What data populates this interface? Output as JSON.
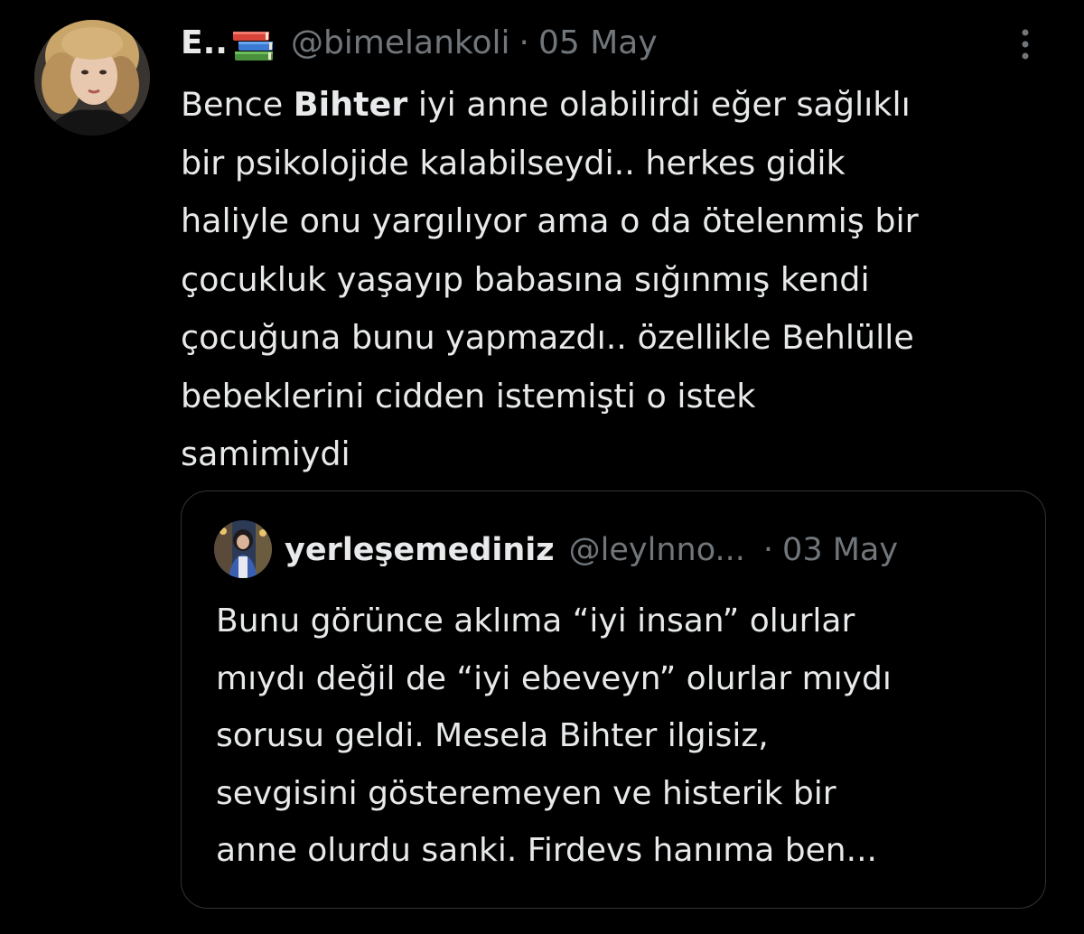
{
  "tweet": {
    "author_name": "E..",
    "author_emoji_icon": "books-icon",
    "handle": "@bimelankoli",
    "separator": "·",
    "date": "05 May",
    "more_icon": "more-vertical-icon",
    "text_lines": [
      {
        "before": "Bence ",
        "bold": "Bihter",
        "after": " iyi anne olabilirdi eğer sağlıklı"
      },
      {
        "text": "bir psikolojide kalabilseydi.. herkes gidik"
      },
      {
        "text": "haliyle onu yargılıyor ama o da ötelenmiş bir"
      },
      {
        "text": "çocukluk yaşayıp babasına sığınmış kendi"
      },
      {
        "text": "çocuğuna bunu yapmazdı.. özellikle Behlülle"
      },
      {
        "text": "bebeklerini cidden istemişti o istek"
      },
      {
        "text": "samimiydi"
      }
    ]
  },
  "quoted_tweet": {
    "author_name": "yerleşemediniz",
    "handle": "@leylnno...",
    "separator": "·",
    "date": "03 May",
    "text_lines": [
      "Bunu görünce aklıma “iyi insan” olurlar",
      "mıydı değil de “iyi ebeveyn” olurlar mıydı",
      "sorusu geldi. Mesela Bihter ilgisiz,",
      "sevgisini gösteremeyen ve histerik bir",
      "anne olurdu sanki. Firdevs hanıma ben..."
    ]
  },
  "colors": {
    "background": "#000000",
    "text_primary": "#e7e9ea",
    "text_secondary": "#71767b",
    "border": "#2f3336"
  }
}
